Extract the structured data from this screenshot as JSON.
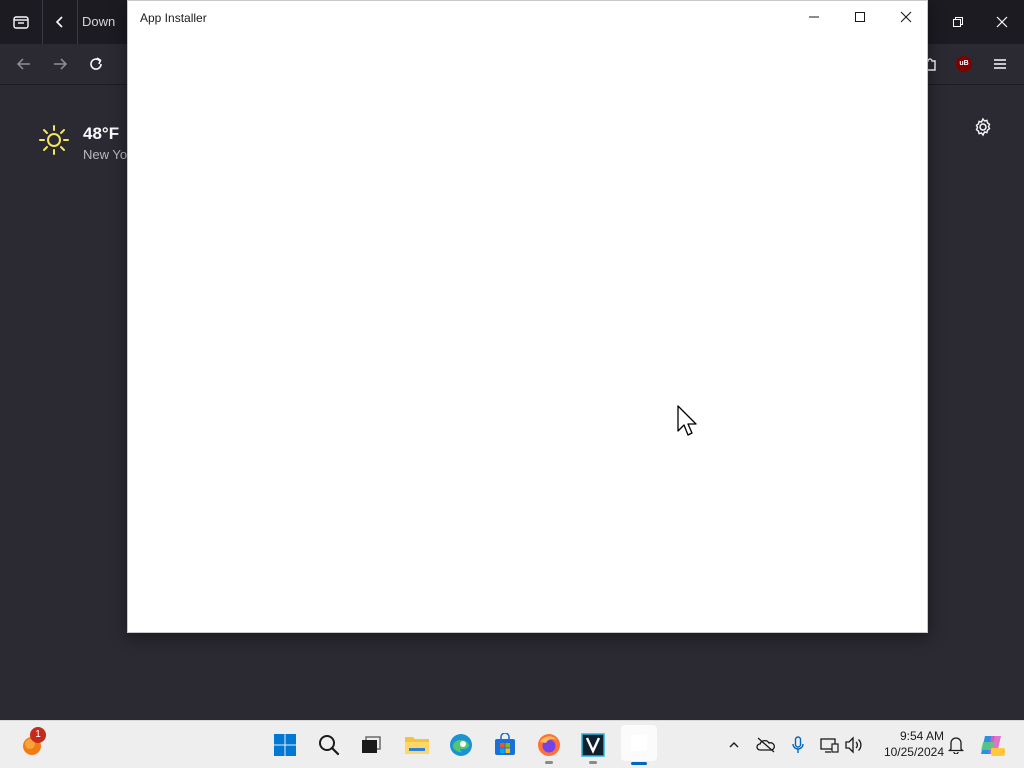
{
  "browser": {
    "active_tab_title": "Down",
    "weather": {
      "temperature": "48°F",
      "location": "New Yo"
    },
    "extension_badge": "uB"
  },
  "app_window": {
    "title": "App Installer",
    "controls": [
      "minimize-icon",
      "maximize-icon",
      "close-icon"
    ]
  },
  "taskbar": {
    "widgets_badge": "1",
    "pinned": [
      "start",
      "search",
      "task-view",
      "file-explorer",
      "edge",
      "microsoft-store",
      "firefox",
      "vmware",
      "app-installer"
    ],
    "clock": {
      "time": "9:54 AM",
      "date": "10/25/2024"
    }
  },
  "colors": {
    "browser_bg": "#2b2a33",
    "tabbar_bg": "#1c1b22",
    "taskbar_bg": "#eeeeee",
    "accent": "#0067c0"
  }
}
